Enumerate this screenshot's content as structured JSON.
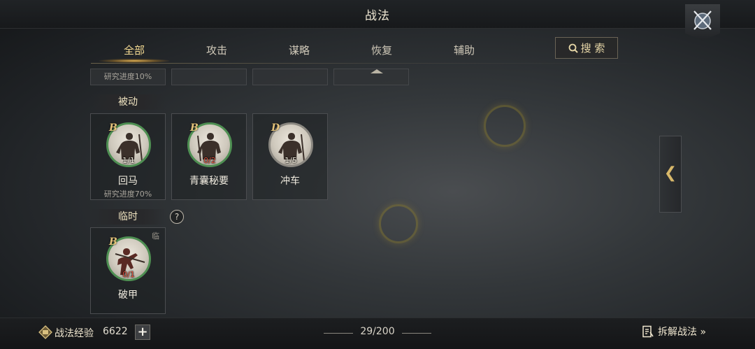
{
  "header": {
    "title": "战法"
  },
  "tabs": [
    {
      "label": "全部",
      "active": true
    },
    {
      "label": "攻击",
      "active": false
    },
    {
      "label": "谋略",
      "active": false
    },
    {
      "label": "恢复",
      "active": false
    },
    {
      "label": "辅助",
      "active": false
    }
  ],
  "search": {
    "label": "搜 索",
    "icon": "search-icon"
  },
  "progress_row": {
    "first": "研究进度10%"
  },
  "sections": {
    "passive": {
      "label": "被动",
      "cards": [
        {
          "grade": "B",
          "count": "1/1",
          "name": "回马",
          "sub": "研究进度70%",
          "ring": "green"
        },
        {
          "grade": "B",
          "count": "0/2",
          "name": "青囊秘要",
          "ring": "green"
        },
        {
          "grade": "D",
          "count": "1/5",
          "name": "冲车",
          "ring": "gray"
        }
      ]
    },
    "temporary": {
      "label": "临时",
      "help": "?",
      "cards": [
        {
          "grade": "B",
          "count": "0/1",
          "name": "破甲",
          "tag": "临",
          "ring": "green"
        }
      ]
    }
  },
  "side_tab": {
    "glyph": "❮"
  },
  "footer": {
    "exp_label": "战法经验",
    "exp_value": "6622",
    "plus": "+",
    "page_count": "29/200",
    "decompose_label": "拆解战法 »"
  },
  "colors": {
    "accent": "#f3d992",
    "green_ring": "#4e8f52",
    "red_count": "#d9513d"
  }
}
